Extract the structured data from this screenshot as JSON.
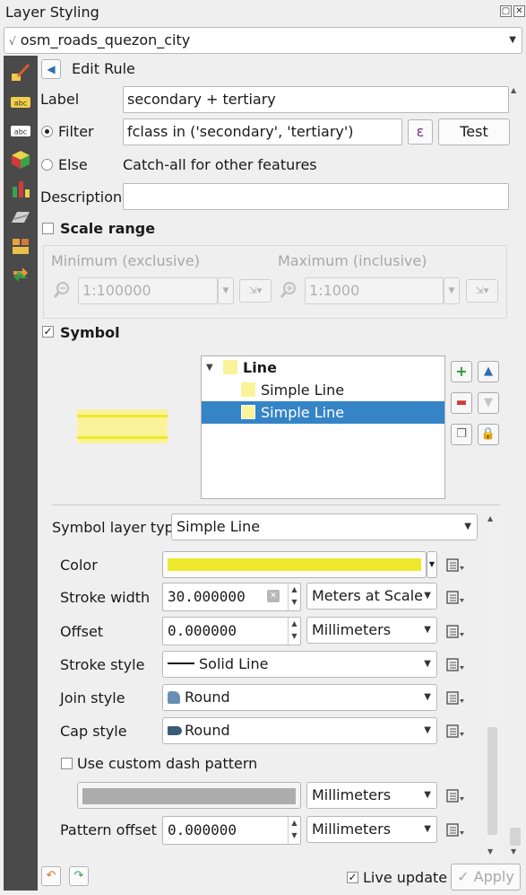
{
  "panel": {
    "title": "Layer Styling",
    "layer": "osm_roads_quezon_city"
  },
  "edit_rule": {
    "title": "Edit Rule"
  },
  "label": {
    "caption": "Label",
    "value": "secondary + tertiary"
  },
  "filter": {
    "caption": "Filter",
    "value": "fclass in ('secondary', 'tertiary')",
    "expr_glyph": "ε",
    "test_label": "Test"
  },
  "else": {
    "caption": "Else",
    "description": "Catch-all for other features"
  },
  "description": {
    "caption": "Description",
    "value": ""
  },
  "scale_range": {
    "caption": "Scale range",
    "checked": false,
    "minimum_caption": "Minimum (exclusive)",
    "minimum_value": "1:100000",
    "maximum_caption": "Maximum (inclusive)",
    "maximum_value": "1:1000"
  },
  "symbol": {
    "caption": "Symbol",
    "checked": true,
    "tree": [
      "Line",
      "Simple Line",
      "Simple Line"
    ],
    "selected_index": 2,
    "swatch_color": "#fbf39a"
  },
  "symbol_layer": {
    "type_caption": "Symbol layer type",
    "type_value": "Simple Line",
    "color": {
      "caption": "Color",
      "value": "#ede82c"
    },
    "stroke_width": {
      "caption": "Stroke width",
      "value": "30.000000",
      "unit": "Meters at Scale"
    },
    "offset": {
      "caption": "Offset",
      "value": "0.000000",
      "unit": "Millimeters"
    },
    "stroke_style": {
      "caption": "Stroke style",
      "value": "Solid Line"
    },
    "join_style": {
      "caption": "Join style",
      "value": "Round"
    },
    "cap_style": {
      "caption": "Cap style",
      "value": "Round"
    },
    "dash": {
      "caption": "Use custom dash pattern",
      "checked": false,
      "unit": "Millimeters"
    },
    "pattern_offset": {
      "caption": "Pattern offset",
      "value": "0.000000",
      "unit": "Millimeters"
    }
  },
  "footer": {
    "live_update": "Live update",
    "live_checked": true,
    "apply": "Apply"
  },
  "colors": {
    "accent": "#3584c6",
    "sidebar": "#4a4a4a",
    "line_yellow": "#fbf39a"
  }
}
